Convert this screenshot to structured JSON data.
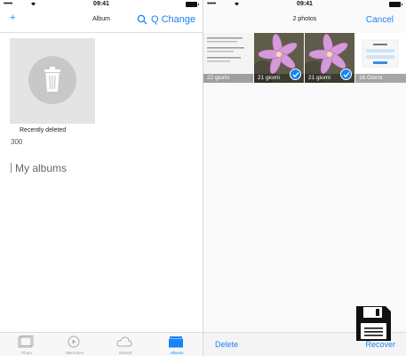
{
  "left": {
    "status": {
      "signal": "•••••",
      "time": "09:41"
    },
    "nav": {
      "plus": "+",
      "title": "Album",
      "change_label": "Q Change"
    },
    "album": {
      "name": "Recently deleted",
      "count": "300"
    },
    "section_title": "My albums",
    "tabs": [
      {
        "label": "Photo",
        "icon": "photos-icon"
      },
      {
        "label": "Memories",
        "icon": "memories-icon"
      },
      {
        "label": "Shared",
        "icon": "cloud-icon"
      },
      {
        "label": "Albums",
        "icon": "albums-icon"
      }
    ]
  },
  "right": {
    "status": {
      "signal": "•••••",
      "time": "09:41"
    },
    "nav": {
      "title": "2 photos",
      "cancel_label": "Cancel"
    },
    "grid": [
      {
        "caption": "22 giorni",
        "selected": false
      },
      {
        "caption": "21 giorni",
        "selected": true
      },
      {
        "caption": "21 giorni",
        "selected": true
      },
      {
        "caption": "16 Giorni",
        "selected": false
      }
    ],
    "bottom": {
      "delete_label": "Delete",
      "recover_label": "Recover"
    }
  },
  "colors": {
    "accent": "#1a82f7",
    "flower": "#c98bd6"
  },
  "overlay_icon": "floppy-disk-icon"
}
